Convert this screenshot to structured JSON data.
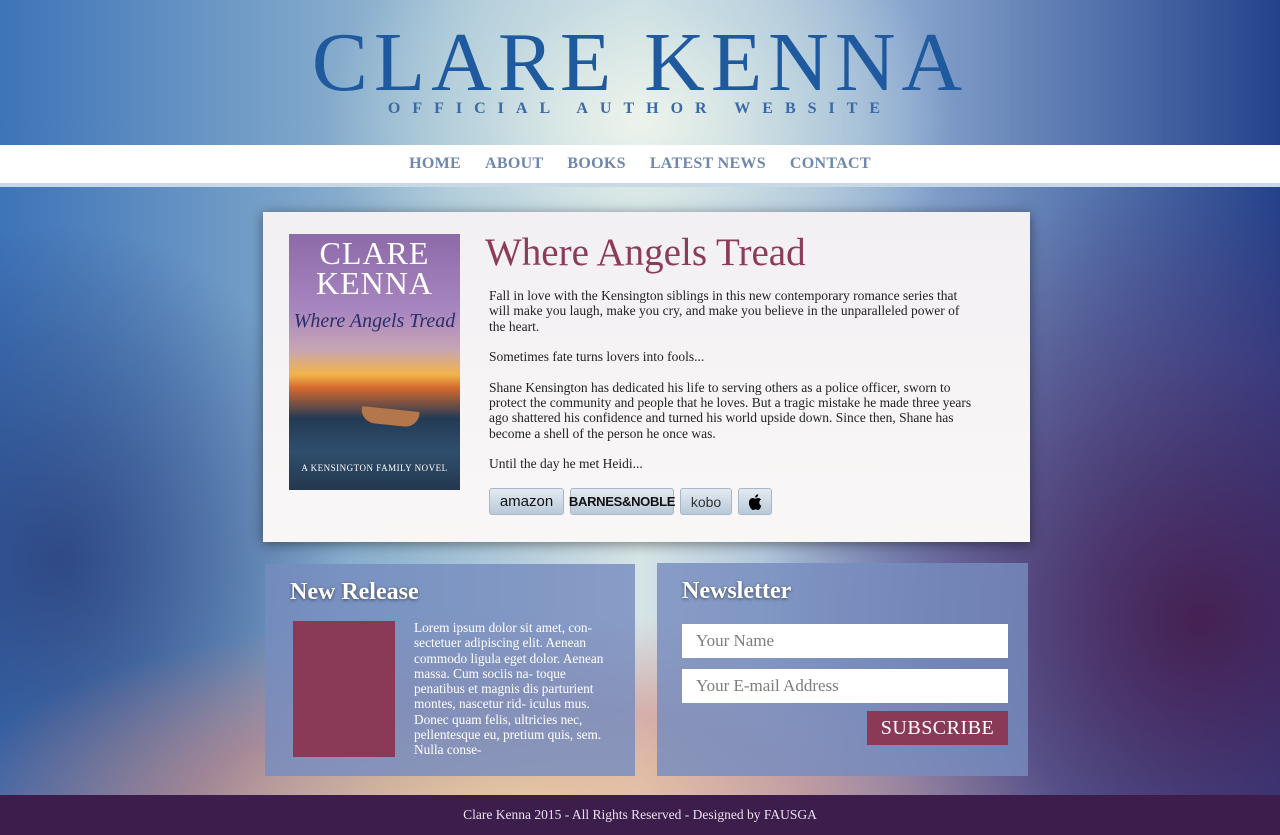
{
  "header": {
    "title": "CLARE KENNA",
    "subtitle": "OFFICIAL AUTHOR WEBSITE"
  },
  "nav": {
    "items": [
      {
        "label": "HOME"
      },
      {
        "label": "ABOUT"
      },
      {
        "label": "BOOKS"
      },
      {
        "label": "LATEST NEWS"
      },
      {
        "label": "CONTACT"
      }
    ]
  },
  "featured": {
    "cover": {
      "author_line1": "CLARE",
      "author_line2": "KENNA",
      "title": "Where Angels Tread",
      "series": "A KENSINGTON FAMILY NOVEL"
    },
    "title": "Where Angels Tread",
    "paragraphs": [
      "Fall in love with the Kensington siblings in this new contemporary romance series that will make you laugh, make you cry, and make you believe in the unparalleled power of the heart.",
      "Sometimes fate turns lovers into fools...",
      "Shane Kensington has dedicated his life to serving others as a police officer, sworn to protect the community and people that he loves. But a tragic mistake he made three years ago shattered his confidence and turned his world upside down. Since then, Shane has become a shell of the person he once was.",
      "Until the day he met Heidi..."
    ],
    "stores": {
      "amazon": "amazon",
      "bn": "BARNES&NOBLE",
      "kobo": "kobo",
      "apple": "apple-icon"
    }
  },
  "new_release": {
    "title": "New Release",
    "text": "Lorem ipsum dolor sit amet, con- sectetuer adipiscing elit. Aenean commodo ligula eget dolor. Aenean massa. Cum sociis na- toque penatibus et magnis dis parturient montes, nascetur rid- iculus mus. Donec quam felis, ultricies nec, pellentesque eu, pretium quis, sem. Nulla conse-"
  },
  "newsletter": {
    "title": "Newsletter",
    "name_placeholder": "Your Name",
    "email_placeholder": "Your E-mail Address",
    "subscribe_label": "SUBSCRIBE"
  },
  "footer": {
    "text": "Clare Kenna 2015 - All Rights Reserved - Designed by FAUSGA"
  },
  "colors": {
    "brand_blue": "#1f5a9e",
    "accent_plum": "#8a3a57",
    "footer_bg": "#3d1d4c",
    "nav_text": "#6e87ad"
  }
}
